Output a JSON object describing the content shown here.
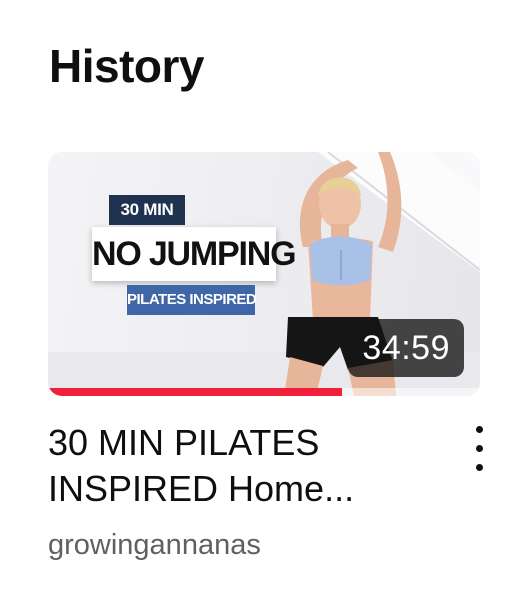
{
  "section": {
    "title": "History"
  },
  "video": {
    "thumbnail": {
      "tag_top": "30 MIN",
      "tag_main": "NO JUMPING",
      "tag_bottom": "PILATES INSPIRED"
    },
    "duration": "34:59",
    "watch_progress": 0.68,
    "title": "30 MIN PILATES INSPIRED Home...",
    "channel": "growingannanas",
    "more_icon": "more-vertical-icon"
  },
  "colors": {
    "progress": "#f0203a",
    "tag_dark": "#1f3350",
    "tag_blue": "#3f67a8",
    "channel_text": "#606060"
  }
}
